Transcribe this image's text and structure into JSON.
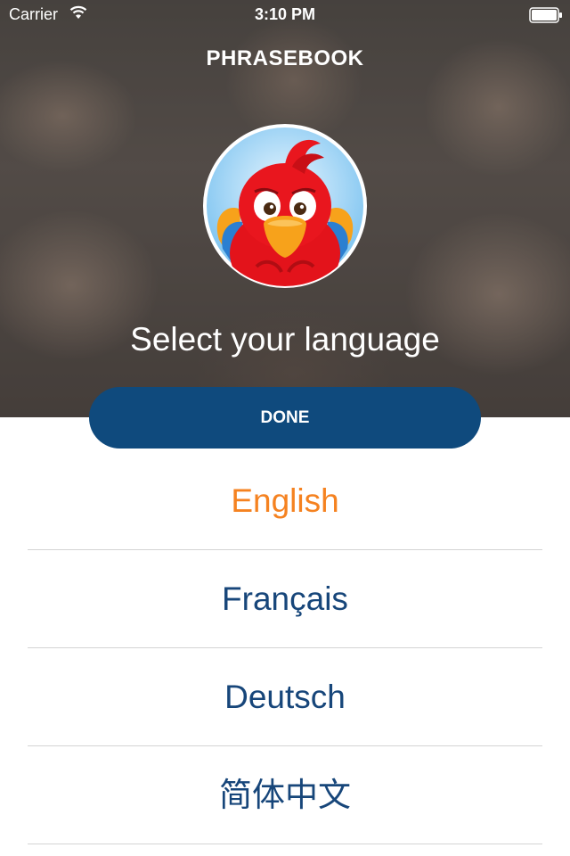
{
  "status_bar": {
    "carrier": "Carrier",
    "time": "3:10 PM"
  },
  "header": {
    "title": "PHRASEBOOK",
    "logo_icon": "parrot-logo-icon",
    "subtitle": "Select your language"
  },
  "done_button": {
    "label": "DONE"
  },
  "languages": {
    "items": [
      {
        "label": "English",
        "selected": true
      },
      {
        "label": "Français",
        "selected": false
      },
      {
        "label": "Deutsch",
        "selected": false
      },
      {
        "label": "简体中文",
        "selected": false
      }
    ]
  },
  "colors": {
    "accent_selected": "#f58220",
    "language_text": "#17467a",
    "button_bg": "#0f4a7d"
  }
}
